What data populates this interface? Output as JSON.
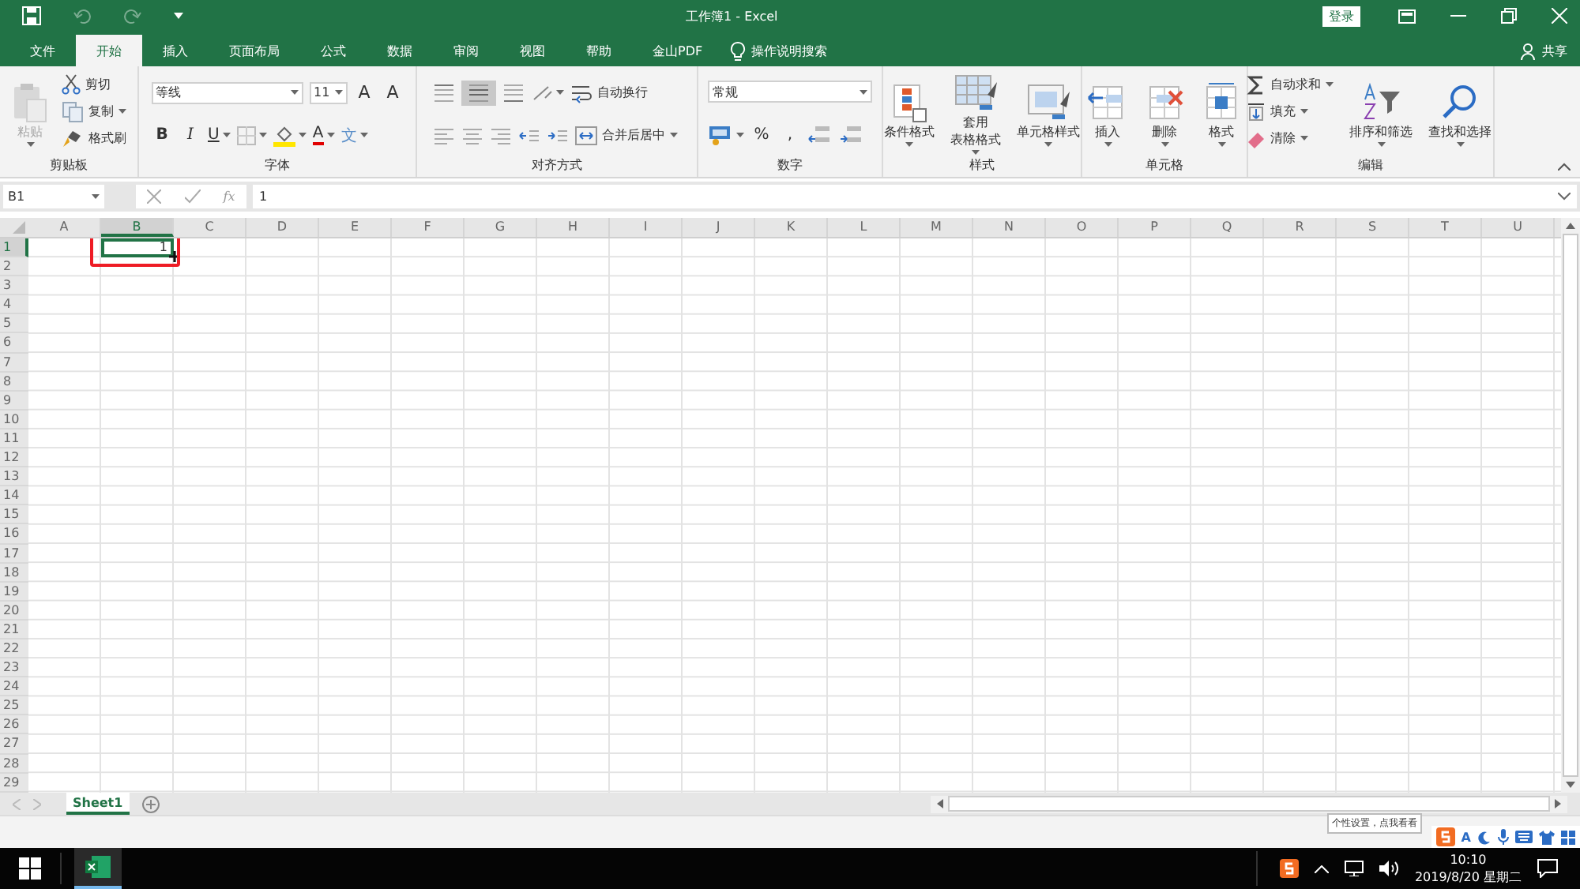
{
  "title_bar": {
    "title": "工作簿1 - Excel",
    "sign_in": "登录",
    "undo_disabled": true,
    "redo_disabled": true
  },
  "tabs": [
    {
      "label": "文件",
      "selected": false
    },
    {
      "label": "开始",
      "selected": true
    },
    {
      "label": "插入",
      "selected": false
    },
    {
      "label": "页面布局",
      "selected": false
    },
    {
      "label": "公式",
      "selected": false
    },
    {
      "label": "数据",
      "selected": false
    },
    {
      "label": "审阅",
      "selected": false
    },
    {
      "label": "视图",
      "selected": false
    },
    {
      "label": "帮助",
      "selected": false
    },
    {
      "label": "金山PDF",
      "selected": false
    }
  ],
  "tell_me": "操作说明搜索",
  "share": "共享",
  "ribbon": {
    "groups": [
      {
        "label": "剪贴板",
        "columns": [
          [
            [
              {
                "kind": "paste",
                "label": "粘贴",
                "disabled": true,
                "dropdown": true
              }
            ]
          ],
          [
            [
              {
                "kind": "cut",
                "label": "剪切"
              }
            ],
            [
              {
                "kind": "copy",
                "label": "复制",
                "dropdown": true
              }
            ],
            [
              {
                "kind": "painter",
                "label": "格式刷"
              }
            ]
          ]
        ]
      },
      {
        "label": "字体",
        "columns": [
          [
            [
              {
                "kind": "fontname",
                "value": "等线"
              },
              {
                "kind": "fontsize",
                "value": "11"
              },
              {
                "kind": "grow",
                "label": "A"
              },
              {
                "kind": "shrink",
                "label": "A"
              }
            ],
            [
              {
                "kind": "bold",
                "label": "B"
              },
              {
                "kind": "italic",
                "label": "I"
              },
              {
                "kind": "underline",
                "label": "U",
                "dropdown": true
              },
              {
                "kind": "border",
                "dropdown": true
              },
              {
                "kind": "highlight",
                "dropdown": true
              },
              {
                "kind": "fontcolor",
                "label": "A",
                "dropdown": true
              },
              {
                "kind": "phonetic",
                "label": "文",
                "dropdown": true
              }
            ]
          ]
        ]
      },
      {
        "label": "对齐方式",
        "columns": [
          [
            [
              {
                "kind": "aligntop",
                "selected": false
              },
              {
                "kind": "alignmiddle",
                "selected": true
              },
              {
                "kind": "alignbottom",
                "selected": false
              },
              {
                "kind": "orientation",
                "dropdown": true
              },
              {
                "kind": "wrap",
                "label": "自动换行"
              }
            ],
            [
              {
                "kind": "alignleft",
                "selected": false
              },
              {
                "kind": "center",
                "selected": false
              },
              {
                "kind": "alignright",
                "selected": false
              },
              {
                "kind": "outdent"
              },
              {
                "kind": "indent"
              },
              {
                "kind": "merge",
                "label": "合并后居中",
                "dropdown": true
              }
            ]
          ]
        ]
      },
      {
        "label": "数字",
        "columns": [
          [
            [
              {
                "kind": "numberformat",
                "value": "常规"
              }
            ],
            [
              {
                "kind": "currency",
                "dropdown": true
              },
              {
                "kind": "percent",
                "label": "%"
              },
              {
                "kind": "comma",
                "label": ","
              },
              {
                "kind": "incdecimal"
              },
              {
                "kind": "decdecimal"
              }
            ]
          ]
        ]
      },
      {
        "label": "样式",
        "columns": [
          [
            [
              {
                "kind": "conditional",
                "label": "条件格式",
                "dropdown": true
              }
            ]
          ],
          [
            [
              {
                "kind": "table",
                "label_lines": [
                  "套用",
                  "表格格式"
                ],
                "dropdown": true
              }
            ]
          ],
          [
            [
              {
                "kind": "cellstyle",
                "label": "单元格样式",
                "dropdown": true
              }
            ]
          ]
        ]
      },
      {
        "label": "单元格",
        "columns": [
          [
            [
              {
                "kind": "insert",
                "label": "插入",
                "dropdown": true
              }
            ]
          ],
          [
            [
              {
                "kind": "delete",
                "label": "删除",
                "dropdown": true
              }
            ]
          ],
          [
            [
              {
                "kind": "format",
                "label": "格式",
                "dropdown": true
              }
            ]
          ]
        ]
      },
      {
        "label": "编辑",
        "columns": [
          [
            [
              {
                "kind": "autosum",
                "label": "自动求和",
                "dropdown": true
              }
            ],
            [
              {
                "kind": "filldown",
                "label": "填充",
                "dropdown": true
              }
            ],
            [
              {
                "kind": "clear",
                "label": "清除",
                "dropdown": true
              }
            ]
          ],
          [
            [
              {
                "kind": "sort",
                "label": "排序和筛选",
                "dropdown": true
              }
            ]
          ],
          [
            [
              {
                "kind": "find",
                "label": "查找和选择",
                "dropdown": true
              }
            ]
          ]
        ]
      }
    ]
  },
  "formula_bar": {
    "name_box": "B1",
    "function_label": "fx",
    "value": "1"
  },
  "sheet": {
    "columns": [
      {
        "label": "A",
        "selected": false
      },
      {
        "label": "B",
        "selected": true
      },
      {
        "label": "C",
        "selected": false
      },
      {
        "label": "D",
        "selected": false
      },
      {
        "label": "E",
        "selected": false
      },
      {
        "label": "F",
        "selected": false
      },
      {
        "label": "G",
        "selected": false
      },
      {
        "label": "H",
        "selected": false
      },
      {
        "label": "I",
        "selected": false
      },
      {
        "label": "J",
        "selected": false
      },
      {
        "label": "K",
        "selected": false
      },
      {
        "label": "L",
        "selected": false
      },
      {
        "label": "M",
        "selected": false
      },
      {
        "label": "N",
        "selected": false
      },
      {
        "label": "O",
        "selected": false
      },
      {
        "label": "P",
        "selected": false
      },
      {
        "label": "Q",
        "selected": false
      },
      {
        "label": "R",
        "selected": false
      },
      {
        "label": "S",
        "selected": false
      },
      {
        "label": "T",
        "selected": false
      },
      {
        "label": "U",
        "selected": false
      }
    ],
    "rows": [
      {
        "label": "1",
        "selected": true
      },
      {
        "label": "2",
        "selected": false
      },
      {
        "label": "3",
        "selected": false
      },
      {
        "label": "4",
        "selected": false
      },
      {
        "label": "5",
        "selected": false
      },
      {
        "label": "6",
        "selected": false
      },
      {
        "label": "7",
        "selected": false
      },
      {
        "label": "8",
        "selected": false
      },
      {
        "label": "9",
        "selected": false
      },
      {
        "label": "10",
        "selected": false
      },
      {
        "label": "11",
        "selected": false
      },
      {
        "label": "12",
        "selected": false
      },
      {
        "label": "13",
        "selected": false
      },
      {
        "label": "14",
        "selected": false
      },
      {
        "label": "15",
        "selected": false
      },
      {
        "label": "16",
        "selected": false
      },
      {
        "label": "17",
        "selected": false
      },
      {
        "label": "18",
        "selected": false
      },
      {
        "label": "19",
        "selected": false
      },
      {
        "label": "20",
        "selected": false
      },
      {
        "label": "21",
        "selected": false
      },
      {
        "label": "22",
        "selected": false
      },
      {
        "label": "23",
        "selected": false
      },
      {
        "label": "24",
        "selected": false
      },
      {
        "label": "25",
        "selected": false
      },
      {
        "label": "26",
        "selected": false
      },
      {
        "label": "27",
        "selected": false
      },
      {
        "label": "28",
        "selected": false
      },
      {
        "label": "29",
        "selected": false
      }
    ],
    "active_value": "1",
    "annotation_box": true
  },
  "sheet_tabs": [
    {
      "label": "Sheet1",
      "selected": true
    }
  ],
  "status_bar": {
    "tooltip": "个性设置，点我看看",
    "ime_mode": "A"
  },
  "taskbar": {
    "apps": [
      {
        "kind": "excel",
        "selected": true
      }
    ],
    "time": "10:10",
    "date": "2019/8/20 星期二"
  }
}
